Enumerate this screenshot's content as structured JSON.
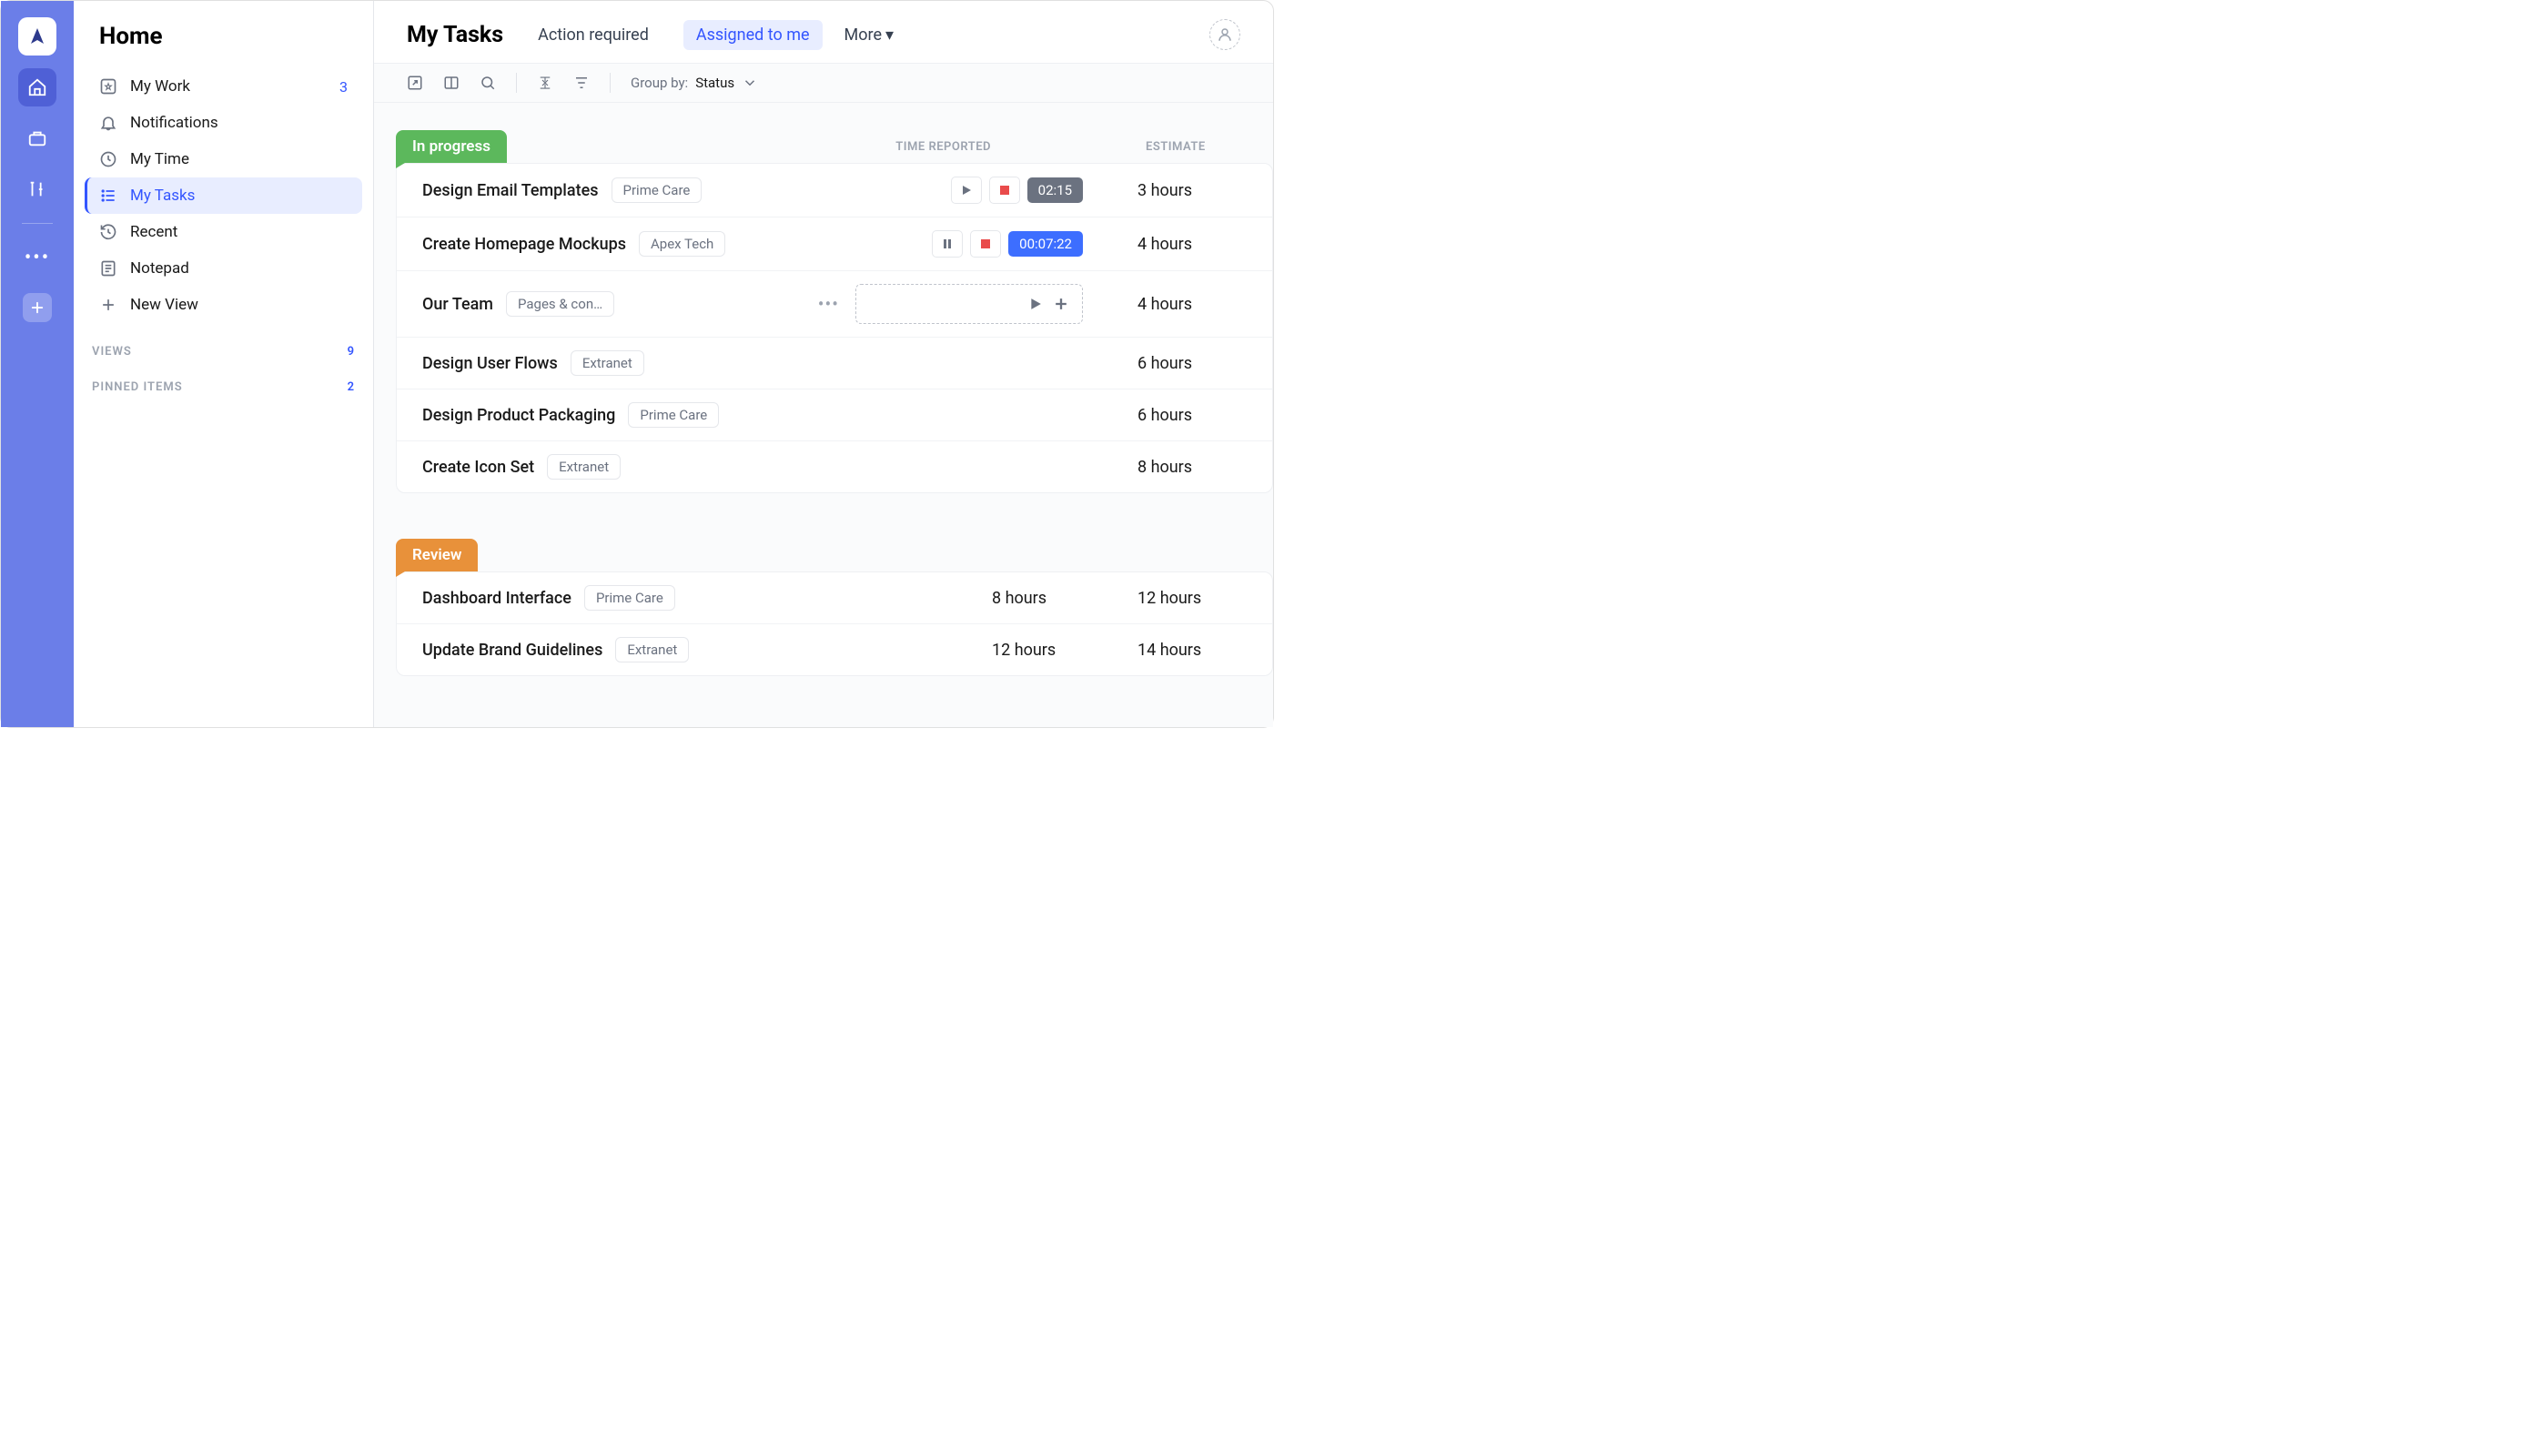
{
  "sidebar": {
    "title": "Home",
    "items": [
      {
        "label": "My Work",
        "badge": "3"
      },
      {
        "label": "Notifications"
      },
      {
        "label": "My Time"
      },
      {
        "label": "My Tasks"
      },
      {
        "label": "Recent"
      },
      {
        "label": "Notepad"
      },
      {
        "label": "New View"
      }
    ],
    "views": {
      "label": "VIEWS",
      "count": "9"
    },
    "pinned": {
      "label": "PINNED ITEMS",
      "count": "2"
    }
  },
  "header": {
    "title": "My Tasks",
    "tabs": {
      "action": "Action required",
      "assigned": "Assigned to me",
      "more": "More"
    }
  },
  "toolbar": {
    "group_by_label": "Group by:",
    "group_by_value": "Status"
  },
  "columns": {
    "time": "TIME REPORTED",
    "estimate": "ESTIMATE"
  },
  "groups": {
    "in_progress": {
      "label": "In progress",
      "tasks": [
        {
          "name": "Design Email Templates",
          "tag": "Prime Care",
          "timer": "02:15",
          "timer_style": "grey",
          "play": true,
          "estimate": "3 hours"
        },
        {
          "name": "Create Homepage Mockups",
          "tag": "Apex Tech",
          "timer": "00:07:22",
          "timer_style": "blue",
          "pause": true,
          "estimate": "4 hours"
        },
        {
          "name": "Our Team",
          "tag": "Pages & con…",
          "hover": true,
          "estimate": "4 hours"
        },
        {
          "name": "Design User Flows",
          "tag": "Extranet",
          "estimate": "6 hours"
        },
        {
          "name": "Design Product Packaging",
          "tag": "Prime Care",
          "estimate": "6 hours"
        },
        {
          "name": "Create Icon Set",
          "tag": "Extranet",
          "estimate": "8 hours"
        }
      ]
    },
    "review": {
      "label": "Review",
      "tasks": [
        {
          "name": "Dashboard Interface",
          "tag": "Prime Care",
          "reported": "8 hours",
          "estimate": "12 hours"
        },
        {
          "name": "Update Brand Guidelines",
          "tag": "Extranet",
          "reported": "12 hours",
          "estimate": "14 hours"
        }
      ]
    }
  }
}
